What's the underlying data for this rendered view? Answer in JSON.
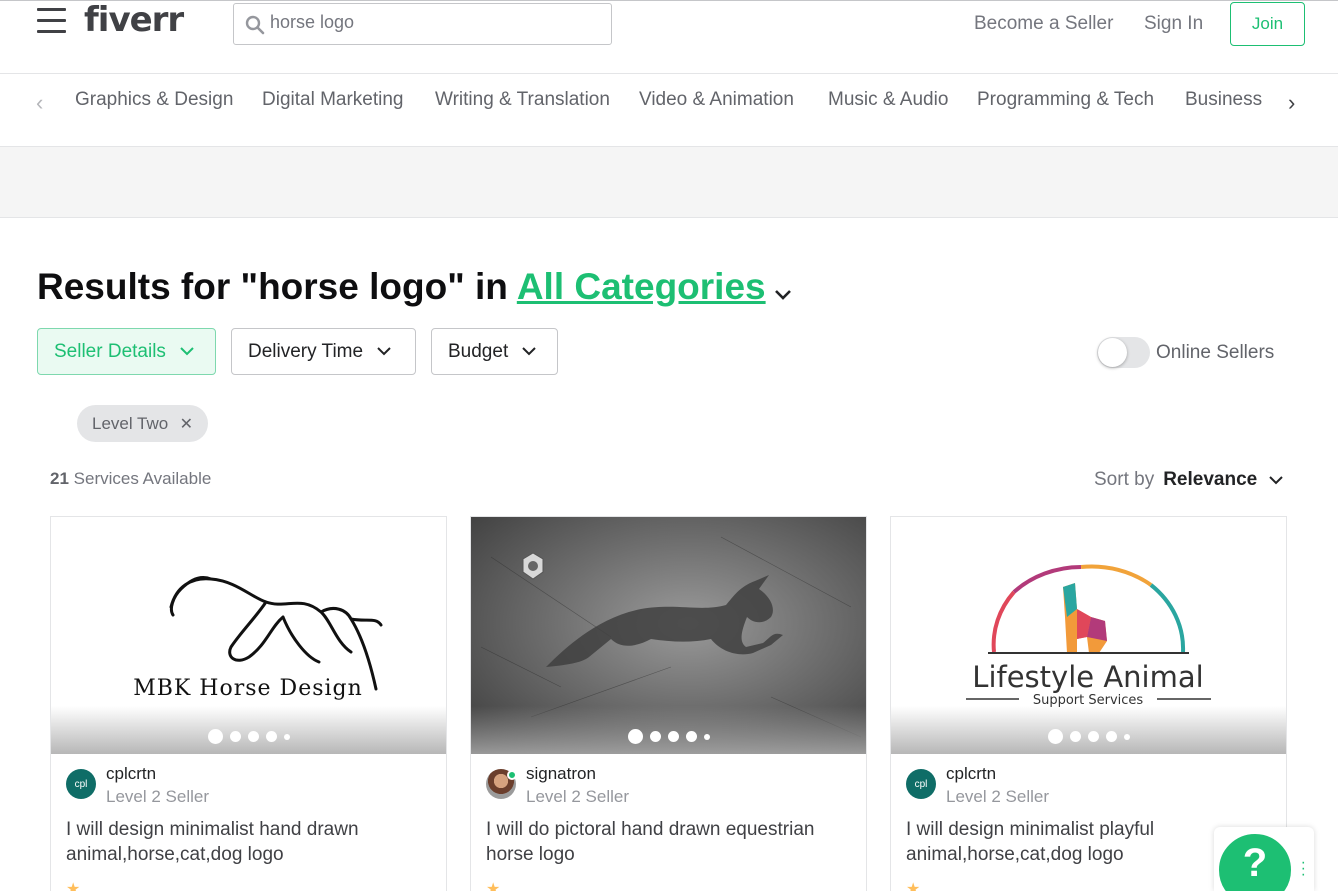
{
  "header": {
    "logo": "fiverr",
    "search_value": "horse logo",
    "become_seller": "Become a Seller",
    "sign_in": "Sign In",
    "join": "Join"
  },
  "categories": [
    "Graphics & Design",
    "Digital Marketing",
    "Writing & Translation",
    "Video & Animation",
    "Music & Audio",
    "Programming & Tech",
    "Business"
  ],
  "results": {
    "prefix": "Results for \"horse logo\" in ",
    "category": "All Categories"
  },
  "filters": {
    "seller_details": "Seller Details",
    "delivery_time": "Delivery Time",
    "budget": "Budget",
    "online_sellers": "Online Sellers",
    "online_sellers_on": false
  },
  "active_chip": "Level Two",
  "count": {
    "number": "21",
    "label": " Services Available"
  },
  "sort": {
    "label": "Sort by",
    "value": "Relevance"
  },
  "cards": [
    {
      "seller": "cplcrtn",
      "level": "Level 2 Seller",
      "avatar_text": "cpl",
      "title": "I will design minimalist hand drawn animal,horse,cat,dog logo",
      "image_text": "MBK Horse Design",
      "online": false,
      "rating": "★"
    },
    {
      "seller": "signatron",
      "level": "Level 2 Seller",
      "avatar_text": "",
      "title": "I will do pictoral hand drawn equestrian horse logo",
      "image_text": "",
      "online": true,
      "rating": "★"
    },
    {
      "seller": "cplcrtn",
      "level": "Level 2 Seller",
      "avatar_text": "cpl",
      "title": "I will design minimalist playful animal,horse,cat,dog logo",
      "image_text": "Lifestyle Animal",
      "image_subtext": "Support Services",
      "online": false,
      "rating": "★"
    }
  ],
  "help_button": "?",
  "colors": {
    "brand_green": "#1dbf73",
    "text_dark": "#222325",
    "text_grey": "#74767e"
  }
}
